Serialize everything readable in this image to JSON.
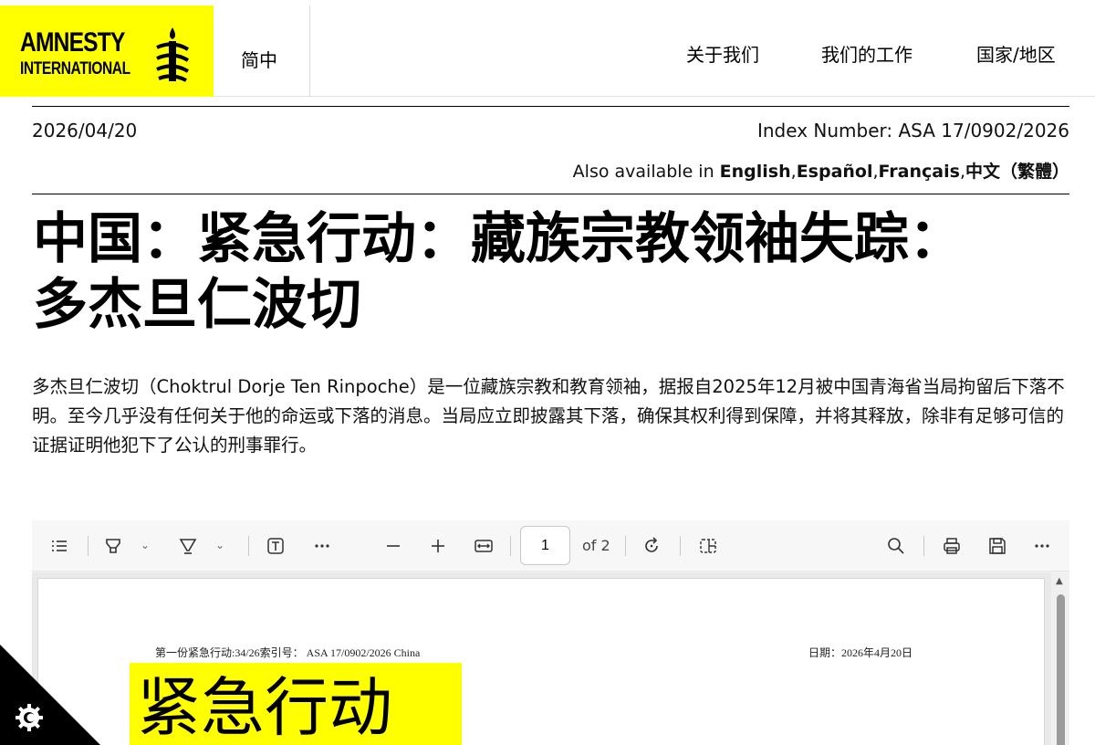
{
  "header": {
    "logo": {
      "line1": "AMNESTY",
      "line2": "INTERNATIONAL"
    },
    "language": "简中",
    "nav": [
      "关于我们",
      "我们的工作",
      "国家/地区"
    ]
  },
  "meta": {
    "date": "2026/04/20",
    "index_number": "Index Number: ASA 17/0902/2026",
    "also_available_prefix": "Also available in ",
    "languages": [
      "English",
      "Español",
      "Français",
      "中文（繁體）"
    ]
  },
  "title": {
    "line1": "中国：紧急行动：藏族宗教领袖失踪：",
    "line2": "多杰旦仁波切"
  },
  "summary": "多杰旦仁波切（Choktrul Dorje Ten Rinpoche）是一位藏族宗教和教育领袖，据报自2025年12月被中国青海省当局拘留后下落不明。至今几乎没有任何关于他的命运或下落的消息。当局应立即披露其下落，确保其权利得到保障，并将其释放，除非有足够可信的证据证明他犯下了公认的刑事罪行。",
  "pdf_viewer": {
    "page_number": "1",
    "page_total": "of 2",
    "page_header_left": "第一份紧急行动:34/26索引号： ASA 17/0902/2026 China",
    "page_header_right": "日期：2026年4月20日",
    "banner_text": "紧急行动"
  },
  "colors": {
    "brand_yellow": "#ffff00",
    "text": "#000000"
  },
  "icons": [
    "candle-logo-icon",
    "contents-icon",
    "highlight-icon",
    "draw-icon",
    "text-icon",
    "more-icon",
    "zoom-out-icon",
    "zoom-in-icon",
    "fit-width-icon",
    "rotate-icon",
    "page-view-icon",
    "search-icon",
    "print-icon",
    "save-icon",
    "cookie-icon"
  ]
}
